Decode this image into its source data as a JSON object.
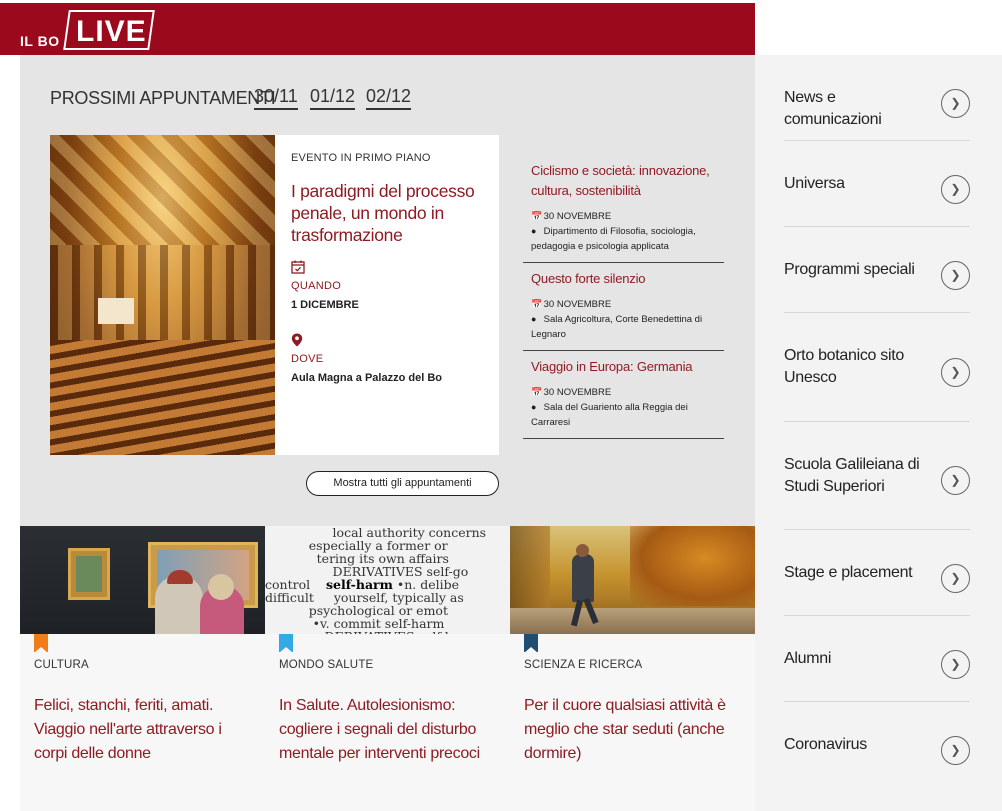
{
  "header": {
    "logo_small": "IL BO",
    "logo_big": "LIVE",
    "brand_color": "#9b0a1c"
  },
  "events": {
    "title": "PROSSIMI APPUNTAMENTI",
    "dates": [
      "30/11",
      "01/12",
      "02/12"
    ],
    "featured": {
      "kicker": "EVENTO IN PRIMO PIANO",
      "title": "I paradigmi del processo penale, un mondo in trasformazione",
      "when_label": "QUANDO",
      "when_value": "1 DICEMBRE",
      "where_label": "DOVE",
      "where_value": "Aula Magna a Palazzo del Bo"
    },
    "list": [
      {
        "title": "Ciclismo e società: innovazione, cultura, sostenibilità",
        "date": "30 NOVEMBRE",
        "place": "Dipartimento di Filosofia, sociologia, pedagogia e psicologia applicata"
      },
      {
        "title": "Questo forte silenzio",
        "date": "30 NOVEMBRE",
        "place": "Sala Agricoltura, Corte Benedettina di Legnaro"
      },
      {
        "title": "Viaggio in Europa: Germania",
        "date": "30 NOVEMBRE",
        "place": "Sala del Guariento alla Reggia dei Carraresi"
      }
    ],
    "all_button": "Mostra tutti gli appuntamenti"
  },
  "sidebar": {
    "items": [
      {
        "label": "News e comunicazioni"
      },
      {
        "label": "Universa"
      },
      {
        "label": "Programmi speciali"
      },
      {
        "label": "Orto botanico sito Unesco"
      },
      {
        "label": "Scuola Galileiana di Studi Superiori"
      },
      {
        "label": "Stage e placement"
      },
      {
        "label": "Alumni"
      },
      {
        "label": "Coronavirus"
      }
    ]
  },
  "cards": [
    {
      "category": "CULTURA",
      "title": "Felici, stanchi, feriti, amati. Viaggio nell'arte attraverso i corpi delle donne",
      "bookmark_color": "#f07d1a"
    },
    {
      "category": "MONDO SALUTE",
      "title": "In Salute. Autolesionismo: cogliere i segnali del disturbo mentale per interventi precoci",
      "bookmark_color": "#35a9e5"
    },
    {
      "category": "SCIENZA E RICERCA",
      "title": "Per il cuore qualsiasi attività è meglio che star seduti (anche dormire)",
      "bookmark_color": "#1f4f70"
    }
  ]
}
